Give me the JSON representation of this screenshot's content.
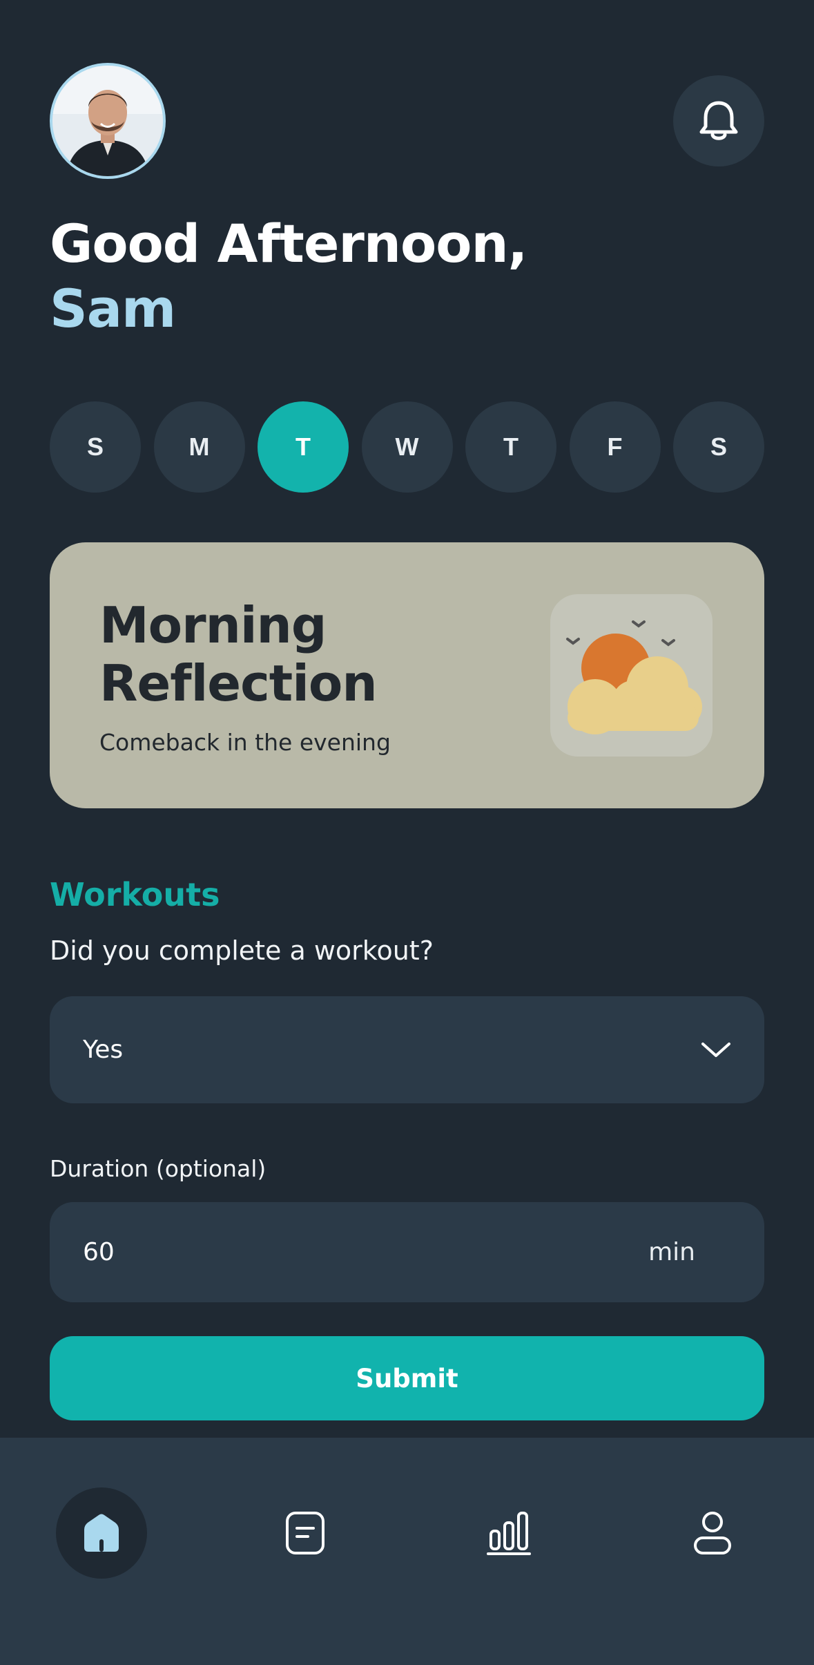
{
  "header": {
    "greeting": "Good Afternoon,",
    "name": "Sam",
    "avatar_icon": "user-avatar-photo",
    "notification_icon": "bell-icon"
  },
  "week": {
    "days": [
      "S",
      "M",
      "T",
      "W",
      "T",
      "F",
      "S"
    ],
    "selected_index": 2
  },
  "reflection_card": {
    "title": "Morning\nReflection",
    "subtitle": "Comeback in the evening",
    "icon": "sun-behind-clouds-icon"
  },
  "workouts": {
    "section_title": "Workouts",
    "question": "Did you complete a workout?",
    "select_value": "Yes",
    "duration_label": "Duration (optional)",
    "duration_value": "60",
    "duration_unit": "min",
    "submit_label": "Submit"
  },
  "nav": {
    "items": [
      {
        "icon": "home-icon",
        "active": true
      },
      {
        "icon": "journal-icon",
        "active": false
      },
      {
        "icon": "stats-icon",
        "active": false
      },
      {
        "icon": "profile-icon",
        "active": false
      }
    ]
  },
  "colors": {
    "background": "#1f2933",
    "accent": "#13b3ac",
    "name_highlight": "#a9d8ee",
    "card": "#b9b9a8",
    "surface": "#2b3a48"
  }
}
